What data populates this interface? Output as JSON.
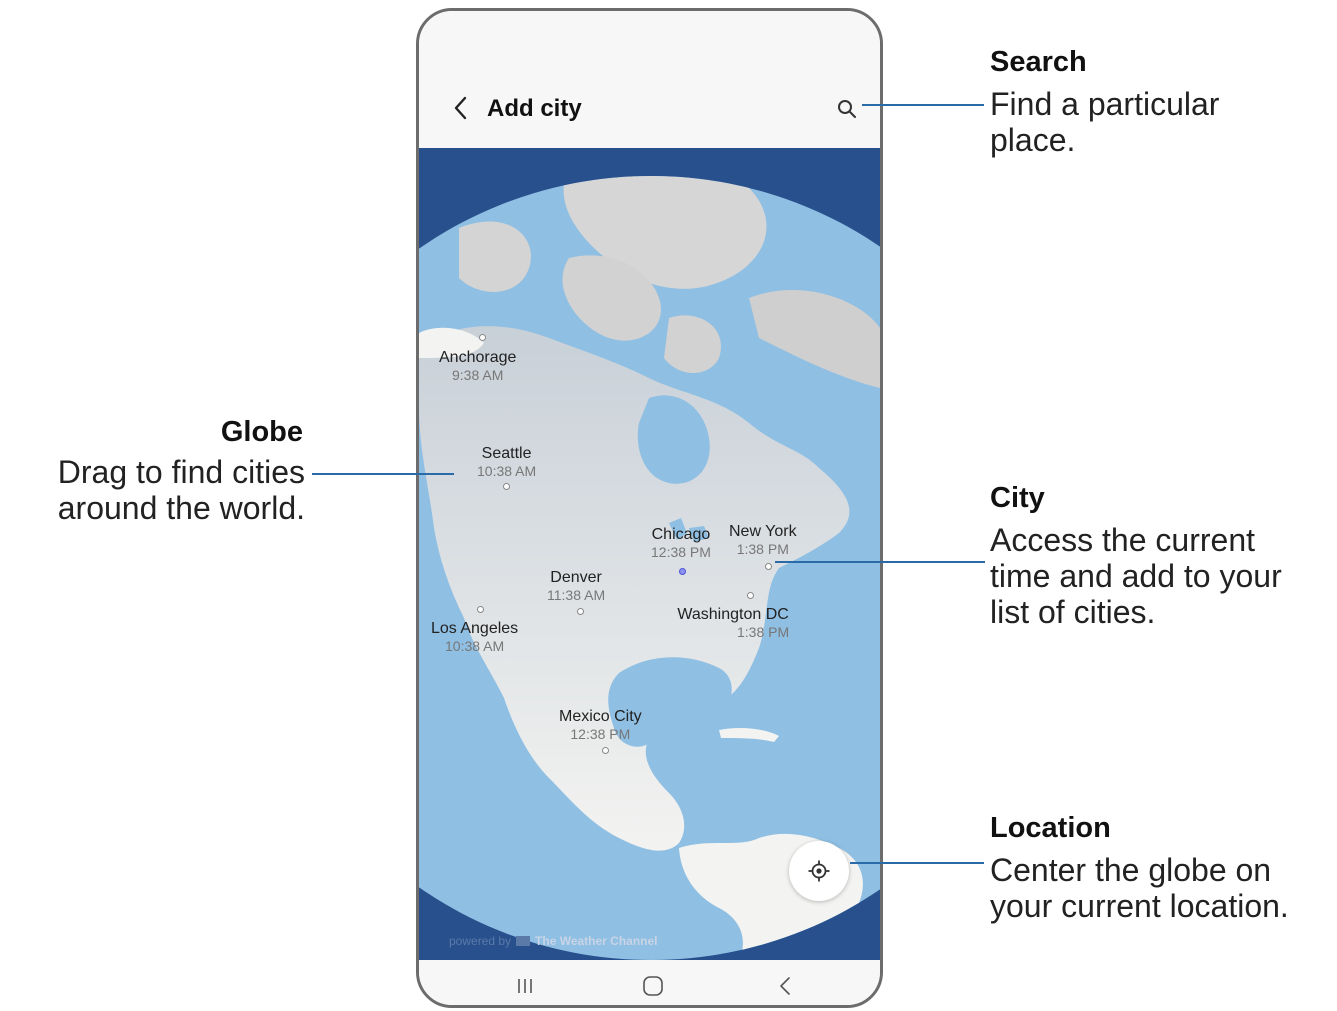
{
  "app": {
    "title": "Add city"
  },
  "icons": {
    "back": "chevron-left-icon",
    "search": "search-icon",
    "locate": "my-location-icon",
    "nav_recents": "recents-icon",
    "nav_home": "home-icon",
    "nav_back": "back-icon"
  },
  "cities": [
    {
      "name": "Anchorage",
      "time": "9:38 AM"
    },
    {
      "name": "Seattle",
      "time": "10:38 AM"
    },
    {
      "name": "Chicago",
      "time": "12:38 PM"
    },
    {
      "name": "New York",
      "time": "1:38 PM"
    },
    {
      "name": "Denver",
      "time": "11:38 AM"
    },
    {
      "name": "Washington DC",
      "time": "1:38 PM"
    },
    {
      "name": "Los Angeles",
      "time": "10:38 AM"
    },
    {
      "name": "Mexico City",
      "time": "12:38 PM"
    }
  ],
  "attribution": {
    "prefix": "powered by",
    "brand": "The Weather Channel"
  },
  "callouts": {
    "search": {
      "title": "Search",
      "desc": "Find a particular place."
    },
    "globe": {
      "title": "Globe",
      "desc": "Drag to find cities around the world."
    },
    "city": {
      "title": "City",
      "desc": "Access the current time and add to your list of cities."
    },
    "location": {
      "title": "Location",
      "desc": "Center the globe on your current location."
    }
  },
  "colors": {
    "ocean": "#8fbfe3",
    "space": "#27508d",
    "land": "#f3f3f1",
    "leader": "#2a6aa8"
  }
}
